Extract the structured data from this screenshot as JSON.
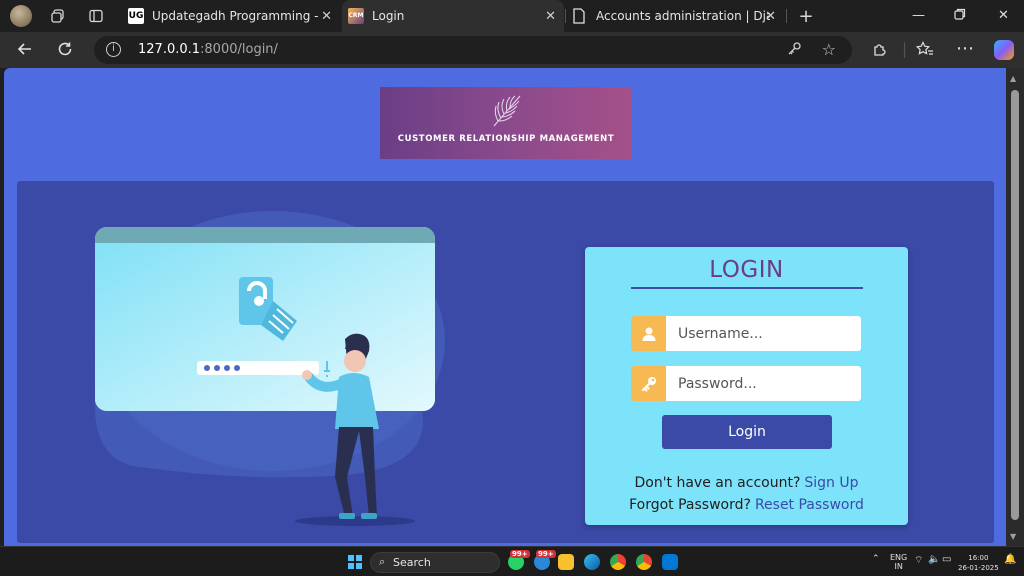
{
  "browser": {
    "tabs": [
      {
        "title": "Updategadh Programming - Upd",
        "favicon": "updategadh-logo"
      },
      {
        "title": "Login",
        "favicon": "crm-logo",
        "active": true
      },
      {
        "title": "Accounts administration | Django",
        "favicon": "page-icon"
      }
    ],
    "address": {
      "host": "127.0.0.1",
      "rest": ":8000/login/"
    }
  },
  "page": {
    "logo_text": "CUSTOMER RELATIONSHIP MANAGEMENT",
    "login": {
      "title": "LOGIN",
      "username_placeholder": "Username...",
      "password_placeholder": "Password...",
      "submit_label": "Login",
      "signup_prompt": "Don't have an account?",
      "signup_link": "Sign Up",
      "forgot_prompt": "Forgot Password?",
      "reset_link": "Reset Password"
    },
    "colors": {
      "page_bg": "#4f6be0",
      "panel_bg": "#3a4aa6",
      "card_bg": "#7de3fb",
      "title_color": "#6b3e80",
      "icon_bg": "#f7b954"
    }
  },
  "taskbar": {
    "search_label": "Search",
    "badges": [
      "99+",
      "99+"
    ],
    "tray": {
      "lang": "ENG",
      "region": "IN",
      "time": "16:00",
      "date": "26-01-2025"
    }
  }
}
